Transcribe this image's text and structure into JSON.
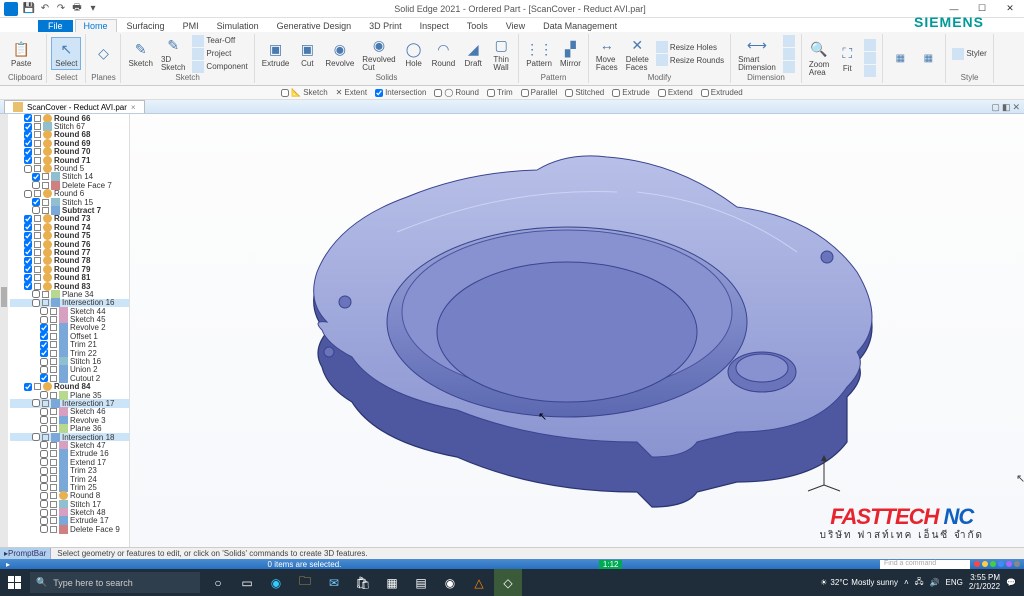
{
  "titlebar": {
    "title": "Solid Edge 2021 - Ordered Part - [ScanCover - Reduct AVI.par]"
  },
  "window_controls": {
    "min": "—",
    "max": "☐",
    "close": "✕"
  },
  "brand": "SIEMENS",
  "file_tab": "File",
  "tabs": [
    "Home",
    "Surfacing",
    "PMI",
    "Simulation",
    "Generative Design",
    "3D Print",
    "Inspect",
    "Tools",
    "View",
    "Data Management"
  ],
  "ribbon": {
    "clipboard": {
      "label": "Clipboard",
      "paste": "Paste"
    },
    "select": {
      "label": "Select",
      "select": "Select"
    },
    "planes": {
      "label": "Planes"
    },
    "sketch": {
      "label": "Sketch",
      "sketch": "Sketch",
      "sketch3d": "3D\nSketch",
      "tearoff": "Tear-Off",
      "project": "Project",
      "component": "Component"
    },
    "solids": {
      "label": "Solids",
      "extrude": "Extrude",
      "cut": "Cut",
      "revolve": "Revolve",
      "revcut": "Revolved\nCut",
      "hole": "Hole",
      "round": "Round",
      "draft": "Draft",
      "thin": "Thin\nWall"
    },
    "pattern": {
      "label": "Pattern",
      "pattern": "Pattern",
      "mirror": "Mirror"
    },
    "modify": {
      "label": "Modify",
      "move": "Move\nFaces",
      "delete": "Delete\nFaces",
      "resize_holes": "Resize Holes",
      "resize_rounds": "Resize Rounds"
    },
    "dimension": {
      "label": "Dimension",
      "smart": "Smart\nDimension"
    },
    "zoom": {
      "zoom": "Zoom\nArea",
      "fit": "Fit"
    },
    "style": {
      "label": "Style",
      "styles": "Styler"
    }
  },
  "sectoolbar": [
    "Sketch",
    "Extent",
    "Intersection",
    "Round",
    "Trim",
    "Parallel",
    "Stitched",
    "Extrude",
    "Extend",
    "Extruded"
  ],
  "doctab": {
    "name": "ScanCover - Reduct AVI.par"
  },
  "tree": [
    {
      "t": "Round 66",
      "c": "round",
      "chk": true,
      "b": true
    },
    {
      "t": "Stitch 67",
      "c": "stitch",
      "chk": true
    },
    {
      "t": "Round 68",
      "c": "round",
      "chk": true,
      "b": true
    },
    {
      "t": "Round 69",
      "c": "round",
      "chk": true,
      "b": true
    },
    {
      "t": "Round 70",
      "c": "round",
      "chk": true,
      "b": true
    },
    {
      "t": "Round 71",
      "c": "round",
      "chk": true,
      "b": true
    },
    {
      "t": "Round 5",
      "c": "round",
      "chk": false
    },
    {
      "t": "Stitch 14",
      "c": "stitch",
      "chk": true,
      "i": 1
    },
    {
      "t": "Delete Face 7",
      "c": "del",
      "chk": false,
      "i": 1
    },
    {
      "t": "Round 6",
      "c": "round",
      "chk": false
    },
    {
      "t": "Stitch 15",
      "c": "stitch",
      "chk": true,
      "i": 1
    },
    {
      "t": "Subtract 7",
      "c": "",
      "chk": false,
      "i": 1,
      "b": true
    },
    {
      "t": "Round 73",
      "c": "round",
      "chk": true,
      "b": true
    },
    {
      "t": "Round 74",
      "c": "round",
      "chk": true,
      "b": true
    },
    {
      "t": "Round 75",
      "c": "round",
      "chk": true,
      "b": true
    },
    {
      "t": "Round 76",
      "c": "round",
      "chk": true,
      "b": true
    },
    {
      "t": "Round 77",
      "c": "round",
      "chk": true,
      "b": true
    },
    {
      "t": "Round 78",
      "c": "round",
      "chk": true,
      "b": true
    },
    {
      "t": "Round 79",
      "c": "round",
      "chk": true,
      "b": true
    },
    {
      "t": "Round 81",
      "c": "round",
      "chk": true,
      "b": true
    },
    {
      "t": "Round 83",
      "c": "round",
      "chk": true,
      "b": true
    },
    {
      "t": "Plane 34",
      "c": "plane",
      "chk": false,
      "i": 1
    },
    {
      "t": "Intersection 16",
      "c": "",
      "chk": false,
      "i": 1,
      "sel": true
    },
    {
      "t": "Sketch 44",
      "c": "sketch",
      "chk": false,
      "i": 2
    },
    {
      "t": "Sketch 45",
      "c": "sketch",
      "chk": false,
      "i": 2
    },
    {
      "t": "Revolve 2",
      "c": "",
      "chk": true,
      "i": 2
    },
    {
      "t": "Offset 1",
      "c": "",
      "chk": true,
      "i": 2
    },
    {
      "t": "Trim 21",
      "c": "",
      "chk": true,
      "i": 2
    },
    {
      "t": "Trim 22",
      "c": "",
      "chk": true,
      "i": 2
    },
    {
      "t": "Stitch 16",
      "c": "stitch",
      "chk": false,
      "i": 2
    },
    {
      "t": "Union 2",
      "c": "",
      "chk": false,
      "i": 2
    },
    {
      "t": "Cutout 2",
      "c": "",
      "chk": true,
      "i": 2
    },
    {
      "t": "Round 84",
      "c": "round",
      "chk": true,
      "b": true
    },
    {
      "t": "Plane 35",
      "c": "plane",
      "chk": false,
      "i": 2
    },
    {
      "t": "Intersection 17",
      "c": "",
      "chk": false,
      "i": 1,
      "sel": true
    },
    {
      "t": "Sketch 46",
      "c": "sketch",
      "chk": false,
      "i": 2
    },
    {
      "t": "Revolve 3",
      "c": "",
      "chk": false,
      "i": 2
    },
    {
      "t": "Plane 36",
      "c": "plane",
      "chk": false,
      "i": 2
    },
    {
      "t": "Intersection 18",
      "c": "",
      "chk": false,
      "i": 1,
      "sel": true
    },
    {
      "t": "Sketch 47",
      "c": "sketch",
      "chk": false,
      "i": 2
    },
    {
      "t": "Extrude 16",
      "c": "",
      "chk": false,
      "i": 2
    },
    {
      "t": "Extend 17",
      "c": "",
      "chk": false,
      "i": 2
    },
    {
      "t": "Trim 23",
      "c": "",
      "chk": false,
      "i": 2
    },
    {
      "t": "Trim 24",
      "c": "",
      "chk": false,
      "i": 2
    },
    {
      "t": "Trim 25",
      "c": "",
      "chk": false,
      "i": 2
    },
    {
      "t": "Round 8",
      "c": "round",
      "chk": false,
      "i": 2
    },
    {
      "t": "Stitch 17",
      "c": "stitch",
      "chk": false,
      "i": 2
    },
    {
      "t": "Sketch 48",
      "c": "sketch",
      "chk": false,
      "i": 2
    },
    {
      "t": "Extrude 17",
      "c": "",
      "chk": false,
      "i": 2
    },
    {
      "t": "Delete Face 9",
      "c": "del",
      "chk": false,
      "i": 2
    }
  ],
  "watermark": {
    "brand": "FASTTECH",
    "nc": "NC",
    "sub": "บริษัท  ฟาสท์เทค  เอ็นซี  จำกัด"
  },
  "prompt": {
    "tag": "PromptBar",
    "msg": "Select geometry or features to edit, or click on 'Solids' commands to create 3D features."
  },
  "status2": {
    "selection": "0 items are selected.",
    "tip": "1:12",
    "search": "Find a command"
  },
  "taskbar": {
    "search": "Type here to search",
    "weather": {
      "temp": "32°C",
      "cond": "Mostly sunny"
    },
    "lang": "ENG",
    "time": "3:55 PM",
    "date": "2/1/2022"
  }
}
